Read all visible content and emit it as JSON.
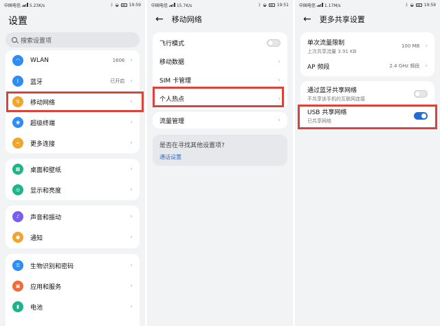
{
  "status": {
    "p1": {
      "carrier": "中国电信",
      "speed": "5.23K/s",
      "time": "19:59"
    },
    "p2": {
      "carrier": "中国电信",
      "speed": "15.7K/s",
      "time": "19:51"
    },
    "p3": {
      "carrier": "中国电信",
      "speed": "1.17M/s",
      "time": "19:59"
    }
  },
  "settings": {
    "title": "设置",
    "search_placeholder": "搜索设置项",
    "group1": [
      {
        "label": "WLAN",
        "value": "1606",
        "icon": "wifi-icon",
        "color": "#2f8cf4"
      },
      {
        "label": "蓝牙",
        "value": "已开启",
        "icon": "bluetooth-icon",
        "color": "#2f8cf4"
      },
      {
        "label": "移动网络",
        "value": "",
        "icon": "mobile-data-icon",
        "color": "#f0a52c"
      },
      {
        "label": "超级终端",
        "value": "",
        "icon": "super-device-icon",
        "color": "#2f8cf4"
      },
      {
        "label": "更多连接",
        "value": "",
        "icon": "link-icon",
        "color": "#f0a52c"
      }
    ],
    "group2": [
      {
        "label": "桌面和壁纸",
        "icon": "home-screen-icon",
        "color": "#1eb48a"
      },
      {
        "label": "显示和亮度",
        "icon": "eye-icon",
        "color": "#1eb48a"
      }
    ],
    "group3": [
      {
        "label": "声音和振动",
        "icon": "sound-icon",
        "color": "#7a5cf0"
      },
      {
        "label": "通知",
        "icon": "bell-icon",
        "color": "#f0a52c"
      }
    ],
    "group4": [
      {
        "label": "生物识别和密码",
        "icon": "key-icon",
        "color": "#2f8cf4"
      },
      {
        "label": "应用和服务",
        "icon": "apps-icon",
        "color": "#f06a3c"
      },
      {
        "label": "电池",
        "icon": "battery-icon",
        "color": "#1eb48a"
      }
    ]
  },
  "mobile": {
    "title": "移动网络",
    "items": [
      {
        "label": "飞行模式",
        "type": "toggle",
        "on": false
      },
      {
        "label": "移动数据",
        "type": "chevron"
      },
      {
        "label": "SIM 卡管理",
        "type": "chevron"
      },
      {
        "label": "个人热点",
        "type": "chevron"
      }
    ],
    "traffic": "流量管理",
    "hint_question": "是否在寻找其他设置项?",
    "hint_link": "通话设置"
  },
  "sharing": {
    "title": "更多共享设置",
    "limit_label": "单次流量限制",
    "limit_sub": "上次共享流量 3.91 KB",
    "limit_value": "100 MB",
    "ap_label": "AP 频段",
    "ap_value": "2.4 GHz 频段",
    "bt_label": "通过蓝牙共享网络",
    "bt_sub": "不共享该手机的互联网连接",
    "bt_on": false,
    "usb_label": "USB 共享网络",
    "usb_sub": "已共享网络",
    "usb_on": true
  },
  "colors": {
    "accent": "#1f6bd8",
    "highlight": "#d9433a"
  }
}
